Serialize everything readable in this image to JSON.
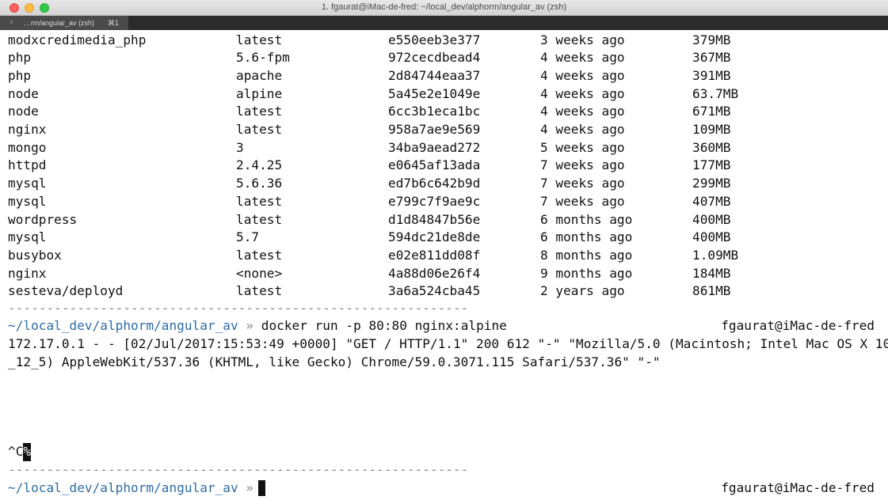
{
  "window": {
    "title": "1. fgaurat@iMac-de-fred: ~/local_dev/alphorm/angular_av (zsh)"
  },
  "tab": {
    "close_glyph": "×",
    "label": "…rm/angular_av (zsh)",
    "shortcut": "⌘1"
  },
  "images": [
    {
      "repository": "modxcredimedia_php",
      "tag": "latest",
      "image_id": "e550eeb3e377",
      "created": "3 weeks ago",
      "size": "379MB"
    },
    {
      "repository": "php",
      "tag": "5.6-fpm",
      "image_id": "972cecdbead4",
      "created": "4 weeks ago",
      "size": "367MB"
    },
    {
      "repository": "php",
      "tag": "apache",
      "image_id": "2d84744eaa37",
      "created": "4 weeks ago",
      "size": "391MB"
    },
    {
      "repository": "node",
      "tag": "alpine",
      "image_id": "5a45e2e1049e",
      "created": "4 weeks ago",
      "size": "63.7MB"
    },
    {
      "repository": "node",
      "tag": "latest",
      "image_id": "6cc3b1eca1bc",
      "created": "4 weeks ago",
      "size": "671MB"
    },
    {
      "repository": "nginx",
      "tag": "latest",
      "image_id": "958a7ae9e569",
      "created": "4 weeks ago",
      "size": "109MB"
    },
    {
      "repository": "mongo",
      "tag": "3",
      "image_id": "34ba9aead272",
      "created": "5 weeks ago",
      "size": "360MB"
    },
    {
      "repository": "httpd",
      "tag": "2.4.25",
      "image_id": "e0645af13ada",
      "created": "7 weeks ago",
      "size": "177MB"
    },
    {
      "repository": "mysql",
      "tag": "5.6.36",
      "image_id": "ed7b6c642b9d",
      "created": "7 weeks ago",
      "size": "299MB"
    },
    {
      "repository": "mysql",
      "tag": "latest",
      "image_id": "e799c7f9ae9c",
      "created": "7 weeks ago",
      "size": "407MB"
    },
    {
      "repository": "wordpress",
      "tag": "latest",
      "image_id": "d1d84847b56e",
      "created": "6 months ago",
      "size": "400MB"
    },
    {
      "repository": "mysql",
      "tag": "5.7",
      "image_id": "594dc21de8de",
      "created": "6 months ago",
      "size": "400MB"
    },
    {
      "repository": "busybox",
      "tag": "latest",
      "image_id": "e02e811dd08f",
      "created": "8 months ago",
      "size": "1.09MB"
    },
    {
      "repository": "nginx",
      "tag": "<none>",
      "image_id": "4a88d06e26f4",
      "created": "9 months ago",
      "size": "184MB"
    },
    {
      "repository": "sesteva/deployd",
      "tag": "latest",
      "image_id": "3a6a524cba45",
      "created": "2 years ago",
      "size": "861MB"
    }
  ],
  "separator": "------------------------------------------------------------",
  "prompt": {
    "path": "~/local_dev/alphorm/angular_av",
    "arrow": "»",
    "user_host": "fgaurat@iMac-de-fred"
  },
  "command": "docker run -p 80:80 nginx:alpine",
  "log_lines": [
    "172.17.0.1 - - [02/Jul/2017:15:53:49 +0000] \"GET / HTTP/1.1\" 200 612 \"-\" \"Mozilla/5.0 (Macintosh; Intel Mac OS X 10",
    "_12_5) AppleWebKit/537.36 (KHTML, like Gecko) Chrome/59.0.3071.115 Safari/537.36\" \"-\""
  ],
  "interrupt": {
    "ctrl_c": "^C",
    "percent": "%"
  }
}
